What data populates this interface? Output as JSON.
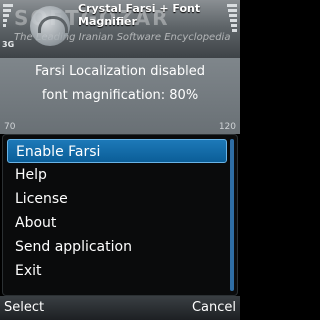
{
  "status_bar": {
    "network": "3G",
    "signal_icon": "signal-strength-icon",
    "battery_icon": "battery-level-icon"
  },
  "header": {
    "app_title": "Crystal Farsi + Font Magnifier",
    "app_icon": "crystal-farsi-app-icon",
    "watermark_main": "SOFTGOZAR",
    "watermark_sub": "The Leading Iranian Software Encyclopedia"
  },
  "content": {
    "status_line_1": "Farsi Localization disabled",
    "status_line_2": "font magnification: 80%",
    "scale_min": "70",
    "scale_max": "120"
  },
  "menu": {
    "items": [
      {
        "label": "Enable Farsi"
      },
      {
        "label": "Help"
      },
      {
        "label": "License"
      },
      {
        "label": "About"
      },
      {
        "label": "Send application"
      },
      {
        "label": "Exit"
      }
    ],
    "highlighted_index": 0
  },
  "softkeys": {
    "left": "Select",
    "right": "Cancel"
  },
  "colors": {
    "highlight": "#1d79b8",
    "menu_bg": "#0a0b0c",
    "content_bg": "#7f868b"
  }
}
